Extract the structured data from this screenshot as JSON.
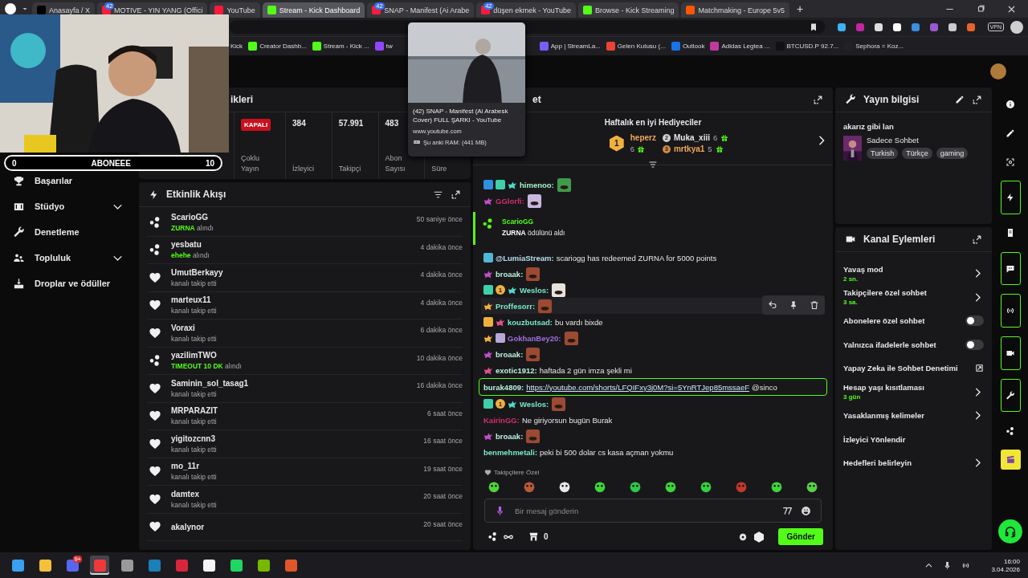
{
  "browser": {
    "tabs": [
      {
        "title": "Anasayfa / X",
        "selected": false
      },
      {
        "title": "MOTIVE - YIN YANG (Offici",
        "badge": "42",
        "selected": false
      },
      {
        "title": "YouTube",
        "selected": false
      },
      {
        "title": "Stream - Kick Dashboard",
        "selected": true
      },
      {
        "title": "SNAP - Manifest (Ai Arabe",
        "badge": "42",
        "selected": false
      },
      {
        "title": "düşen ekmek - YouTube",
        "badge": "42",
        "selected": false
      },
      {
        "title": "Browse - Kick Streaming",
        "selected": false
      },
      {
        "title": "Matchmaking - Europe 5v5",
        "selected": false
      }
    ],
    "new_tab": "+",
    "vpn": "VPN",
    "bookmarks": [
      {
        "title": "Kick"
      },
      {
        "title": "Creator Dashb..."
      },
      {
        "title": "Stream - Kick ..."
      },
      {
        "title": "tw"
      },
      {
        "title": "App | StreamLa..."
      },
      {
        "title": "Gelen Kutusu (..."
      },
      {
        "title": "Outlook"
      },
      {
        "title": "Adidas Legtea ..."
      },
      {
        "title": "BTCUSD.P 92.7..."
      },
      {
        "title": "Sephora = Koz..."
      }
    ],
    "tab_preview": {
      "title": "(42) SNAP - Manifest (Ai Arabesk Cover) FULL ŞARKI - YouTube",
      "url": "www.youtube.com",
      "memory": "Şu anki RAM: (441 MB)"
    }
  },
  "webcam": {
    "goal": {
      "start": "0",
      "label": "ABONEEE",
      "end": "10",
      "level": 0
    }
  },
  "sidebar": {
    "items": [
      {
        "label": "Başarılar",
        "kind": "link"
      },
      {
        "label": "Stüdyo",
        "kind": "group"
      },
      {
        "label": "Denetleme",
        "kind": "link"
      },
      {
        "label": "Topluluk",
        "kind": "group"
      },
      {
        "label": "Droplar ve ödüller",
        "kind": "link"
      }
    ]
  },
  "stats": {
    "title": "ikleri",
    "items": [
      {
        "kind": "badge",
        "value": "KAPALI",
        "label": [
          "Çoklu",
          "Yayın"
        ]
      },
      {
        "kind": "number",
        "value": "384",
        "label": [
          "İzleyici"
        ]
      },
      {
        "kind": "number",
        "value": "57.991",
        "label": [
          "Takipçi"
        ]
      },
      {
        "kind": "number",
        "value": "483",
        "label": [
          "Abon",
          "Sayısı"
        ]
      },
      {
        "kind": "number",
        "label": [
          "Süre"
        ]
      }
    ]
  },
  "activity": {
    "title": "Etkinlik Akışı",
    "events": [
      {
        "kind": "reward",
        "name": "ScarioGG",
        "reward": "ZURNA",
        "detail": "alındı",
        "time": "50 saniye önce"
      },
      {
        "kind": "reward",
        "name": "yesbatu",
        "reward": "ehehe",
        "detail": "alındı",
        "time": "4 dakika önce"
      },
      {
        "kind": "follow",
        "name": "UmutBerkayy",
        "detail": "kanalı takip etti",
        "time": "4 dakika önce"
      },
      {
        "kind": "follow",
        "name": "marteux11",
        "detail": "kanalı takip etti",
        "time": "4 dakika önce"
      },
      {
        "kind": "follow",
        "name": "Voraxi",
        "detail": "kanalı takip etti",
        "time": "6 dakika önce"
      },
      {
        "kind": "reward",
        "name": "yazilimTWO",
        "reward": "TIMEOUT 10 DK",
        "detail": "alındı",
        "time": "10 dakika önce"
      },
      {
        "kind": "follow",
        "name": "Saminin_sol_tasag1",
        "detail": "kanalı takip etti",
        "time": "16 dakika önce"
      },
      {
        "kind": "follow",
        "name": "MRPARAZIT",
        "detail": "kanalı takip etti",
        "time": "6 saat önce"
      },
      {
        "kind": "follow",
        "name": "yigitozcnn3",
        "detail": "kanalı takip etti",
        "time": "16 saat önce"
      },
      {
        "kind": "follow",
        "name": "mo_11r",
        "detail": "kanalı takip etti",
        "time": "19 saat önce"
      },
      {
        "kind": "follow",
        "name": "damtex",
        "detail": "kanalı takip etti",
        "time": "20 saat önce"
      },
      {
        "kind": "follow",
        "name": "akalynor",
        "time": "20 saat önce"
      }
    ]
  },
  "chat": {
    "title": "et",
    "gifters_title": "Haftalık en iyi Hediyeciler",
    "gifters": [
      {
        "rank": "1",
        "name": "heperz",
        "count": "6",
        "color": "#f2a65a"
      },
      {
        "rank": "2",
        "name": "Muka_xiii",
        "count": "6",
        "color": "#e8e8e8"
      },
      {
        "rank": "3",
        "name": "mrtkya1",
        "count": "5",
        "color": "#f2a65a"
      }
    ],
    "messages": [
      {
        "kind": "emote",
        "badges": [
          {
            "kind": "mod"
          },
          {
            "kind": "og"
          },
          {
            "kind": "sub",
            "color": "#4fd8c8"
          }
        ],
        "name": "himenoo:",
        "color": "#a8f0c8"
      },
      {
        "kind": "emote",
        "badges": [
          {
            "kind": "sub",
            "color": "#c04fc8"
          }
        ],
        "name": "GGlorfi:",
        "color": "#d0306a"
      },
      {
        "kind": "reward",
        "name": "ScarioGG",
        "text": "**ZURNA** ödülünü aldı"
      },
      {
        "kind": "msg",
        "badges": [
          {
            "kind": "bot"
          }
        ],
        "name": "@LumiaStream:",
        "color": "#b8dff0",
        "text": "scariogg has redeemed ZURNA for 5000 points"
      },
      {
        "kind": "emote",
        "badges": [
          {
            "kind": "sub",
            "color": "#c04fc8"
          }
        ],
        "name": "broaak:",
        "color": "#b8f0dc"
      },
      {
        "kind": "emote",
        "badges": [
          {
            "kind": "og"
          },
          {
            "kind": "rank",
            "label": "1"
          },
          {
            "kind": "sub",
            "color": "#4fd8c8"
          }
        ],
        "name": "Weslos:",
        "color": "#7de8c8"
      },
      {
        "kind": "emote",
        "badges": [
          {
            "kind": "sub",
            "color": "#f0b040"
          }
        ],
        "name": "Proffesorr:",
        "color": "#7de8c8",
        "hovered": true
      },
      {
        "kind": "msg",
        "badges": [
          {
            "kind": "crown"
          },
          {
            "kind": "sub",
            "color": "#e0508a"
          }
        ],
        "name": "kouzbutsad:",
        "color": "#7de8c8",
        "text": "bu vardı bixde"
      },
      {
        "kind": "emote",
        "badges": [
          {
            "kind": "sub",
            "color": "#f0b040"
          },
          {
            "kind": "gift"
          }
        ],
        "name": "GokhanBey20:",
        "color": "#a070d8"
      },
      {
        "kind": "emote",
        "badges": [
          {
            "kind": "sub",
            "color": "#c04fc8"
          }
        ],
        "name": "broaak:",
        "color": "#b8f0dc"
      },
      {
        "kind": "msg",
        "badges": [
          {
            "kind": "sub",
            "color": "#e0508a"
          }
        ],
        "name": "exotic1912:",
        "color": "#b8f0dc",
        "text": "haftada 2 gün imza şekli mi"
      },
      {
        "kind": "link",
        "name": "burak4809:",
        "color": "#b8f0dc",
        "link": "https://youtube.com/shorts/LFQIFxy3j0M?si=5YnRTJep85mssaeF",
        "text": "@sinco"
      },
      {
        "kind": "emote",
        "badges": [
          {
            "kind": "og"
          },
          {
            "kind": "rank",
            "label": "1"
          },
          {
            "kind": "sub",
            "color": "#4fd8c8"
          }
        ],
        "name": "Weslos:",
        "color": "#7de8c8"
      },
      {
        "kind": "msg",
        "name": "KairinGG:",
        "color": "#d0306a",
        "text": "Ne giriyorsun bugün Burak"
      },
      {
        "kind": "emote",
        "badges": [
          {
            "kind": "sub",
            "color": "#c04fc8"
          }
        ],
        "name": "broaak:",
        "color": "#b8f0dc"
      },
      {
        "kind": "msg",
        "name": "benmehmetali:",
        "color": "#7de8c8",
        "text": "peki bi 500 dolar cs kasa açman yokmu"
      }
    ],
    "emote_set": "Takipçilere Özel",
    "placeholder": "Bir mesaj gönderin",
    "store_count": "0",
    "send": "Gönder"
  },
  "stream_info": {
    "title": "Yayın bilgisi",
    "stream_title": "akarız gibi lan",
    "category": "Sadece Sohbet",
    "tags": [
      "Turkish",
      "Türkçe",
      "gaming"
    ]
  },
  "channel_actions": {
    "title": "Kanal Eylemleri",
    "items": [
      {
        "label": "Yavaş mod",
        "value": "2 sn.",
        "kind": "chevron"
      },
      {
        "label": "Takipçilere özel sohbet",
        "value": "3 sa.",
        "kind": "chevron"
      },
      {
        "label": "Abonelere özel sohbet",
        "kind": "toggle",
        "on": false
      },
      {
        "label": "Yalnızca ifadelerle sohbet",
        "kind": "toggle",
        "on": false
      },
      {
        "label": "Yapay Zeka ile Sohbet Denetimi",
        "kind": "external"
      },
      {
        "label": "Hesap yaşı kısıtlaması",
        "value": "3 gün",
        "kind": "chevron"
      },
      {
        "label": "Yasaklanmış kelimeler",
        "kind": "chevron"
      },
      {
        "label": "İzleyici Yönlendir",
        "kind": "plain"
      },
      {
        "label": "Hedefleri belirleyin",
        "kind": "chevron"
      }
    ]
  },
  "rail": [
    {
      "kind": "info",
      "active": false
    },
    {
      "kind": "pencil",
      "active": false
    },
    {
      "kind": "focus",
      "active": false
    },
    {
      "kind": "bolt",
      "active": true
    },
    {
      "kind": "doc",
      "active": false
    },
    {
      "kind": "chat",
      "active": true
    },
    {
      "kind": "broadcast",
      "active": true
    },
    {
      "kind": "video",
      "active": true
    },
    {
      "kind": "wrench",
      "active": true
    },
    {
      "kind": "points",
      "active": false
    },
    {
      "kind": "clapper",
      "active": false
    }
  ],
  "taskbar": {
    "apps": [
      {
        "kind": "windows",
        "active": false
      },
      {
        "kind": "folder",
        "active": false
      },
      {
        "kind": "discord",
        "active": false,
        "badge": "9+"
      },
      {
        "kind": "vivaldi",
        "active": true
      },
      {
        "kind": "clock",
        "active": false
      },
      {
        "kind": "steam",
        "active": false
      },
      {
        "kind": "fist",
        "active": false
      },
      {
        "kind": "box",
        "active": false
      },
      {
        "kind": "spotify",
        "active": false
      },
      {
        "kind": "gpu",
        "active": false
      },
      {
        "kind": "shield",
        "active": false
      }
    ],
    "time": "16:00",
    "date": "3.04.2026"
  }
}
